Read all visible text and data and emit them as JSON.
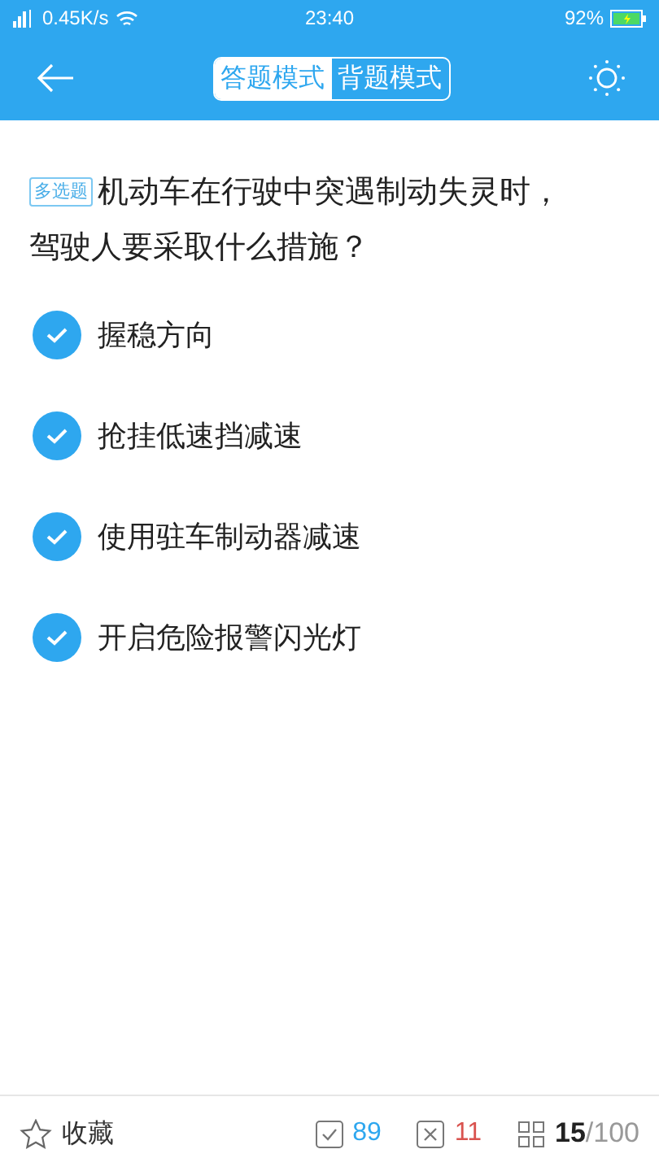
{
  "status_bar": {
    "speed": "0.45K/s",
    "time": "23:40",
    "battery": "92%"
  },
  "header": {
    "tabs": [
      {
        "label": "答题模式",
        "selected": true
      },
      {
        "label": "背题模式",
        "selected": false
      }
    ]
  },
  "question": {
    "tag": "多选题",
    "text": "机动车在行驶中突遇制动失灵时，驾驶人要采取什么措施？"
  },
  "options": [
    {
      "text": "握稳方向",
      "checked": true
    },
    {
      "text": "抢挂低速挡减速",
      "checked": true
    },
    {
      "text": "使用驻车制动器减速",
      "checked": true
    },
    {
      "text": "开启危险报警闪光灯",
      "checked": true
    }
  ],
  "footer": {
    "favorite": "收藏",
    "correct": "89",
    "wrong": "11",
    "progress": "**15**/100"
  }
}
